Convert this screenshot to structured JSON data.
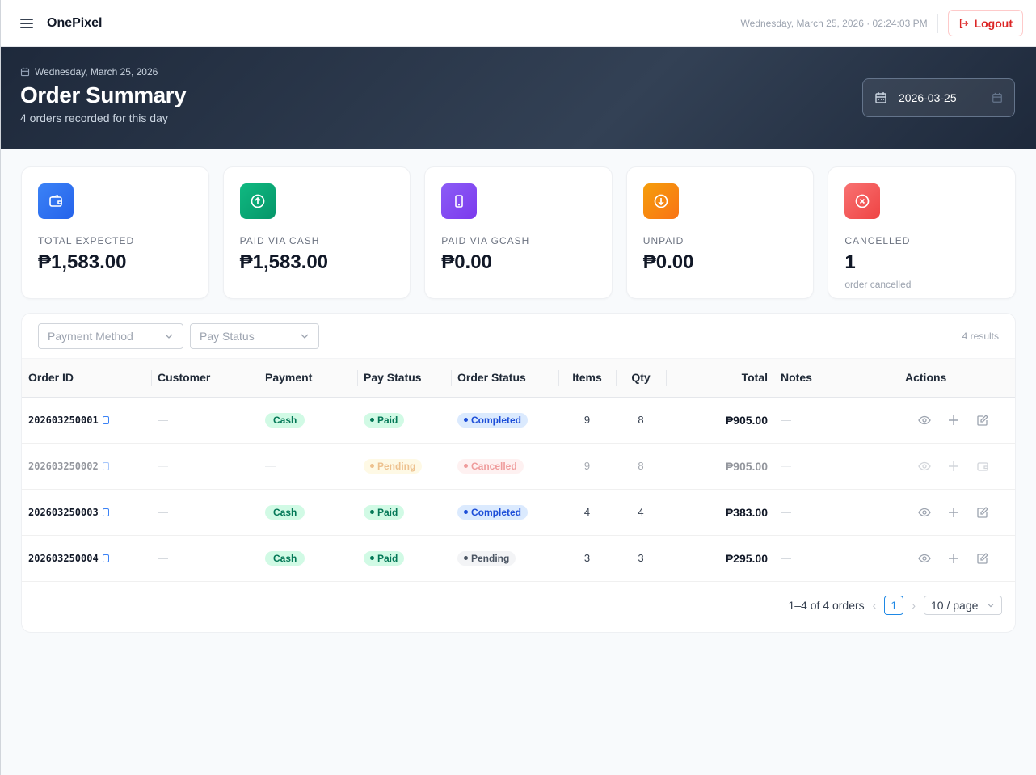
{
  "app": {
    "brand": "OnePixel",
    "clock": "Wednesday, March 25, 2026 · 02:24:03 PM",
    "logout_label": "Logout"
  },
  "hero": {
    "date": "Wednesday, March 25, 2026",
    "title": "Order Summary",
    "subtitle": "4 orders recorded for this day",
    "date_picker_value": "2026-03-25"
  },
  "cards": [
    {
      "label": "TOTAL EXPECTED",
      "value": "₱1,583.00",
      "icon": "wallet-icon",
      "color": "#3b82f6"
    },
    {
      "label": "PAID VIA CASH",
      "value": "₱1,583.00",
      "icon": "arrow-up-circle-icon",
      "color": "#10b981"
    },
    {
      "label": "PAID VIA GCASH",
      "value": "₱0.00",
      "icon": "mobile-icon",
      "color": "#8b5cf6"
    },
    {
      "label": "UNPAID",
      "value": "₱0.00",
      "icon": "arrow-down-circle-icon",
      "color": "#f59e0b"
    },
    {
      "label": "CANCELLED",
      "value": "1",
      "sub": "order cancelled",
      "icon": "close-circle-icon",
      "color": "#ef4444"
    }
  ],
  "filters": {
    "payment_method_placeholder": "Payment Method",
    "pay_status_placeholder": "Pay Status",
    "results": "4 results"
  },
  "table": {
    "columns": [
      "Order ID",
      "Customer",
      "Payment",
      "Pay Status",
      "Order Status",
      "Items",
      "Qty",
      "Total",
      "Notes",
      "Actions"
    ],
    "rows": [
      {
        "order_id": "202603250001",
        "customer": "—",
        "payment": "Cash",
        "pay_status": "Paid",
        "order_status": "Completed",
        "items": "9",
        "qty": "8",
        "total": "₱905.00",
        "notes": "—"
      },
      {
        "order_id": "202603250002",
        "customer": "—",
        "payment": "—",
        "pay_status": "Pending",
        "order_status": "Cancelled",
        "items": "9",
        "qty": "8",
        "total": "₱905.00",
        "notes": "—"
      },
      {
        "order_id": "202603250003",
        "customer": "—",
        "payment": "Cash",
        "pay_status": "Paid",
        "order_status": "Completed",
        "items": "4",
        "qty": "4",
        "total": "₱383.00",
        "notes": "—"
      },
      {
        "order_id": "202603250004",
        "customer": "—",
        "payment": "Cash",
        "pay_status": "Paid",
        "order_status": "Pending",
        "items": "3",
        "qty": "3",
        "total": "₱295.00",
        "notes": "—"
      }
    ]
  },
  "pagination": {
    "range": "1–4 of 4 orders",
    "current_page": "1",
    "page_size": "10 / page"
  }
}
